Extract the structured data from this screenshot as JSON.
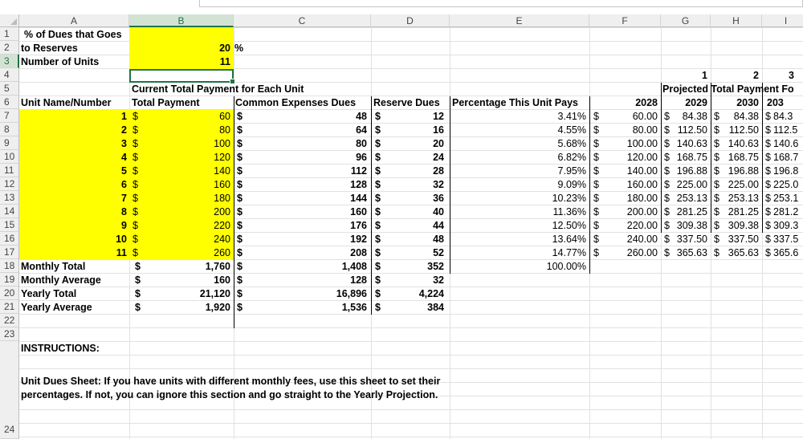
{
  "columns": [
    "A",
    "B",
    "C",
    "D",
    "E",
    "F",
    "G",
    "H",
    "I"
  ],
  "rows": [
    "1",
    "2",
    "3",
    "4",
    "5",
    "6",
    "7",
    "8",
    "9",
    "10",
    "11",
    "12",
    "13",
    "14",
    "15",
    "16",
    "17",
    "18",
    "19",
    "20",
    "21",
    "22",
    "23",
    "24"
  ],
  "header": {
    "a1_top": "% of Dues that Goes",
    "a1": "to Reserves",
    "b1": "20",
    "b1_unit": "%",
    "a2": "Number of Units",
    "b2": "11",
    "b4": "Current Total Payment for Each Unit",
    "a5": "Unit Name/Number",
    "b5": "Total Payment",
    "c5": "Common Expenses Dues",
    "d5": "Reserve Dues",
    "e5": "Percentage This Unit Pays",
    "g3": "1",
    "h3": "2",
    "i3": "3",
    "g4": "Projected Total Payment Fo",
    "f5": "2028",
    "g5": "2029",
    "h5": "2030",
    "i5": "203"
  },
  "units": [
    {
      "n": "1",
      "total": "60",
      "common": "48",
      "reserve": "12",
      "pct": "3.41%",
      "f": "60.00",
      "g": "84.38",
      "h": "84.38",
      "i": "84.3"
    },
    {
      "n": "2",
      "total": "80",
      "common": "64",
      "reserve": "16",
      "pct": "4.55%",
      "f": "80.00",
      "g": "112.50",
      "h": "112.50",
      "i": "112.5"
    },
    {
      "n": "3",
      "total": "100",
      "common": "80",
      "reserve": "20",
      "pct": "5.68%",
      "f": "100.00",
      "g": "140.63",
      "h": "140.63",
      "i": "140.6"
    },
    {
      "n": "4",
      "total": "120",
      "common": "96",
      "reserve": "24",
      "pct": "6.82%",
      "f": "120.00",
      "g": "168.75",
      "h": "168.75",
      "i": "168.7"
    },
    {
      "n": "5",
      "total": "140",
      "common": "112",
      "reserve": "28",
      "pct": "7.95%",
      "f": "140.00",
      "g": "196.88",
      "h": "196.88",
      "i": "196.8"
    },
    {
      "n": "6",
      "total": "160",
      "common": "128",
      "reserve": "32",
      "pct": "9.09%",
      "f": "160.00",
      "g": "225.00",
      "h": "225.00",
      "i": "225.0"
    },
    {
      "n": "7",
      "total": "180",
      "common": "144",
      "reserve": "36",
      "pct": "10.23%",
      "f": "180.00",
      "g": "253.13",
      "h": "253.13",
      "i": "253.1"
    },
    {
      "n": "8",
      "total": "200",
      "common": "160",
      "reserve": "40",
      "pct": "11.36%",
      "f": "200.00",
      "g": "281.25",
      "h": "281.25",
      "i": "281.2"
    },
    {
      "n": "9",
      "total": "220",
      "common": "176",
      "reserve": "44",
      "pct": "12.50%",
      "f": "220.00",
      "g": "309.38",
      "h": "309.38",
      "i": "309.3"
    },
    {
      "n": "10",
      "total": "240",
      "common": "192",
      "reserve": "48",
      "pct": "13.64%",
      "f": "240.00",
      "g": "337.50",
      "h": "337.50",
      "i": "337.5"
    },
    {
      "n": "11",
      "total": "260",
      "common": "208",
      "reserve": "52",
      "pct": "14.77%",
      "f": "260.00",
      "g": "365.63",
      "h": "365.63",
      "i": "365.6"
    }
  ],
  "summary": [
    {
      "label": "Monthly Total",
      "total": "1,760",
      "common": "1,408",
      "reserve": "352",
      "pct": "100.00%"
    },
    {
      "label": "Monthly Average",
      "total": "160",
      "common": "128",
      "reserve": "32",
      "pct": ""
    },
    {
      "label": "Yearly Total",
      "total": "21,120",
      "common": "16,896",
      "reserve": "4,224",
      "pct": ""
    },
    {
      "label": "Yearly Average",
      "total": "1,920",
      "common": "1,536",
      "reserve": "384",
      "pct": ""
    }
  ],
  "currency": "$",
  "instructions_title": "INSTRUCTIONS:",
  "instructions_body": "Unit Dues Sheet: If you have units with different monthly fees, use this sheet to set their percentages. If not, you can ignore this section and go straight to the Yearly Projection.",
  "colors": {
    "highlight": "#ffff00",
    "select": "#217346"
  }
}
